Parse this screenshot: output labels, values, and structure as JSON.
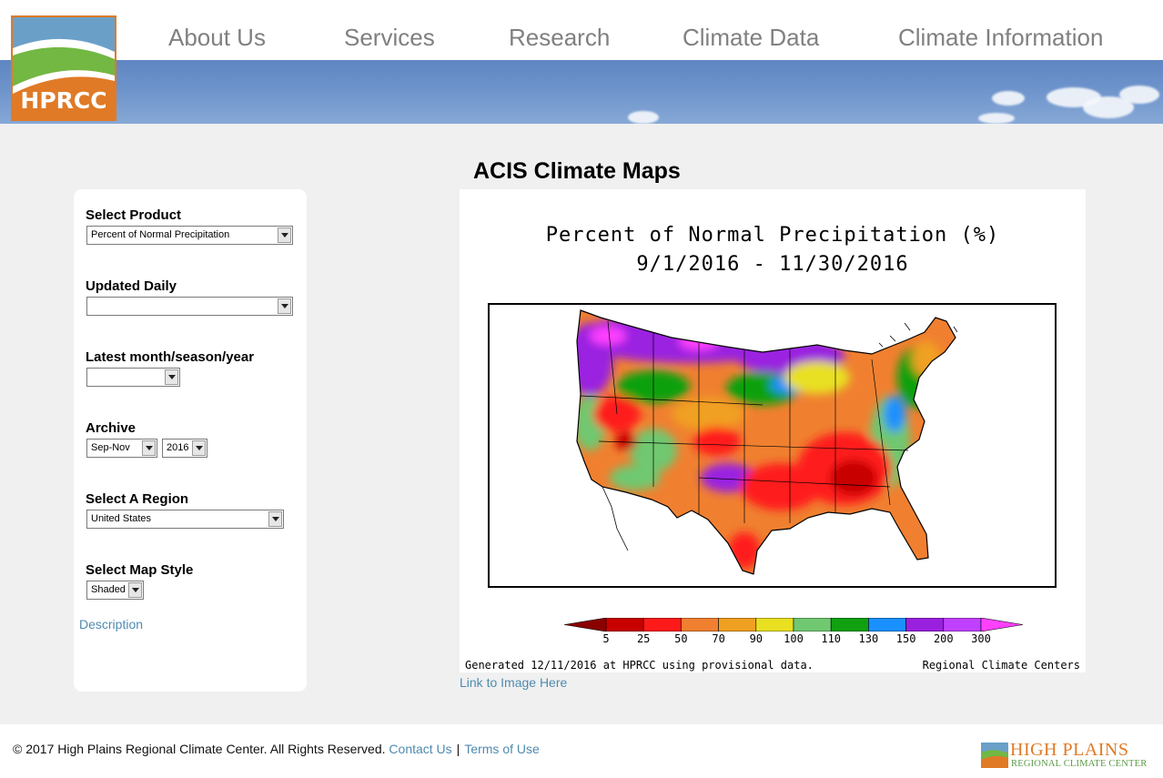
{
  "header": {
    "logo_text": "HPRCC",
    "nav": [
      "About Us",
      "Services",
      "Research",
      "Climate Data",
      "Climate Information"
    ]
  },
  "page": {
    "title": "ACIS Climate Maps"
  },
  "sidebar": {
    "product": {
      "label": "Select Product",
      "value": "Percent of Normal Precipitation"
    },
    "daily": {
      "label": "Updated Daily",
      "value": ""
    },
    "latest": {
      "label": "Latest month/season/year",
      "value": ""
    },
    "archive": {
      "label": "Archive",
      "season": "Sep-Nov",
      "year": "2016"
    },
    "region": {
      "label": "Select A Region",
      "value": "United States"
    },
    "style": {
      "label": "Select Map Style",
      "value": "Shaded"
    },
    "description_link": "Description"
  },
  "map": {
    "title_line1": "Percent of Normal Precipitation (%)",
    "title_line2": "9/1/2016 - 11/30/2016",
    "footer_left": "Generated 12/11/2016 at HPRCC using provisional data.",
    "footer_right": "Regional Climate Centers",
    "legend_values": [
      "5",
      "25",
      "50",
      "70",
      "90",
      "100",
      "110",
      "130",
      "150",
      "200",
      "300"
    ],
    "legend_colors": [
      "#8b0000",
      "#c80000",
      "#ff1a1a",
      "#f08030",
      "#f0a020",
      "#e8e020",
      "#70c870",
      "#10a010",
      "#1a90ff",
      "#9a20e0",
      "#c040ff",
      "#ff40ff"
    ],
    "link": "Link to Image Here"
  },
  "footer": {
    "copyright": "© 2017 High Plains Regional Climate Center. All Rights Reserved.",
    "contact": "Contact Us",
    "separator": "|",
    "terms": "Terms of Use",
    "logo_main": "HIGH PLAINS",
    "logo_sub": "REGIONAL CLIMATE CENTER"
  }
}
